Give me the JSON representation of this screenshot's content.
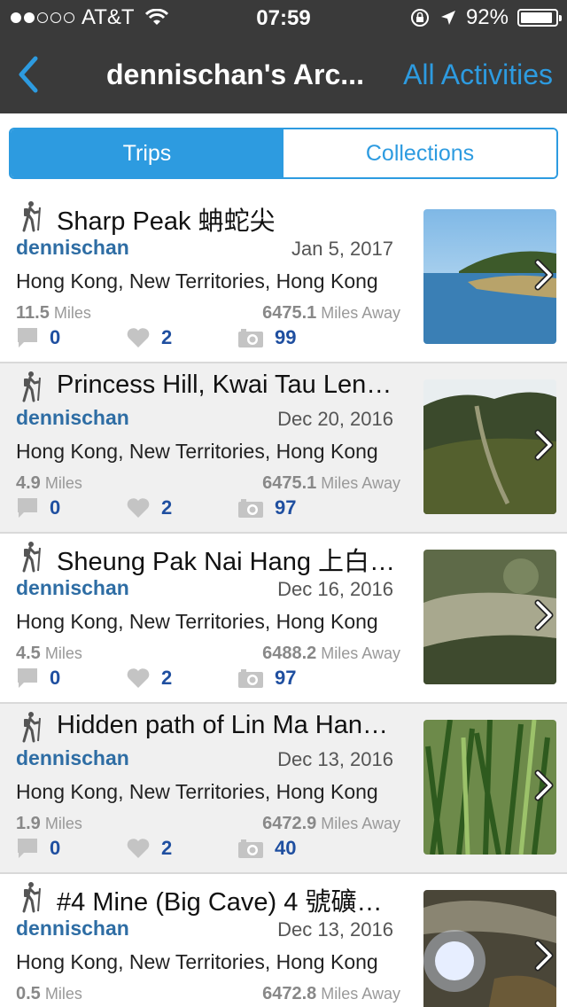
{
  "status_bar": {
    "carrier": "AT&T",
    "time": "07:59",
    "battery": "92%",
    "battery_level": 0.92,
    "signal_bars_filled": 2,
    "signal_bars_total": 5,
    "icons": [
      "wifi-icon",
      "rotation-lock-icon",
      "location-arrow-icon",
      "battery-icon"
    ]
  },
  "nav": {
    "title": "dennischan's Arc...",
    "right_action": "All Activities",
    "back_icon": "chevron-left-icon",
    "accent_color": "#2d9be0",
    "bar_color": "#3a3a3a"
  },
  "tabs": [
    {
      "label": "Trips",
      "active": true
    },
    {
      "label": "Collections",
      "active": false
    }
  ],
  "trips": [
    {
      "title": "Sharp Peak 蚺蛇尖",
      "author": "dennischan",
      "date": "Jan 5, 2017",
      "location": "Hong Kong, New Territories, Hong Kong",
      "miles": "11.5",
      "miles_unit": "Miles",
      "away": "6475.1",
      "away_unit": "Miles Away",
      "comments": "0",
      "likes": "2",
      "photos": "99"
    },
    {
      "title": "Princess Hill, Kwai Tau Len…",
      "author": "dennischan",
      "date": "Dec 20, 2016",
      "location": "Hong Kong, New Territories, Hong Kong",
      "miles": "4.9",
      "miles_unit": "Miles",
      "away": "6475.1",
      "away_unit": "Miles Away",
      "comments": "0",
      "likes": "2",
      "photos": "97"
    },
    {
      "title": "Sheung Pak Nai Hang 上白…",
      "author": "dennischan",
      "date": "Dec 16, 2016",
      "location": "Hong Kong, New Territories, Hong Kong",
      "miles": "4.5",
      "miles_unit": "Miles",
      "away": "6488.2",
      "away_unit": "Miles Away",
      "comments": "0",
      "likes": "2",
      "photos": "97"
    },
    {
      "title": "Hidden path of Lin Ma Han…",
      "author": "dennischan",
      "date": "Dec 13, 2016",
      "location": "Hong Kong, New Territories, Hong Kong",
      "miles": "1.9",
      "miles_unit": "Miles",
      "away": "6472.9",
      "away_unit": "Miles Away",
      "comments": "0",
      "likes": "2",
      "photos": "40"
    },
    {
      "title": "#4 Mine (Big Cave) 4 號礦…",
      "author": "dennischan",
      "date": "Dec 13, 2016",
      "location": "Hong Kong, New Territories, Hong Kong",
      "miles": "0.5",
      "miles_unit": "Miles",
      "away": "6472.8",
      "away_unit": "Miles Away",
      "comments": "",
      "likes": "",
      "photos": ""
    }
  ]
}
